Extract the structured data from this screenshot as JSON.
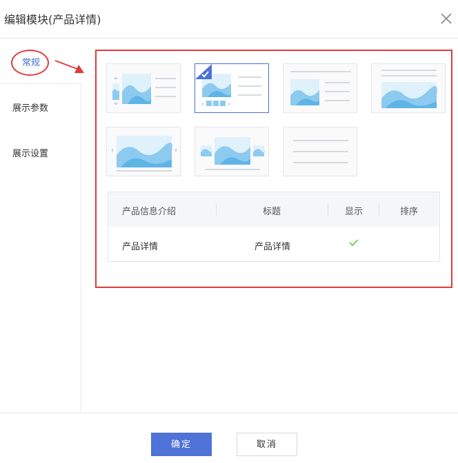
{
  "dialog": {
    "title": "编辑模块(产品详情)",
    "close_icon": "close-icon"
  },
  "sidebar": {
    "items": [
      {
        "label": "常规",
        "active": true
      },
      {
        "label": "展示参数",
        "active": false
      },
      {
        "label": "展示设置",
        "active": false
      }
    ]
  },
  "templates": {
    "selected_index": 1,
    "count": 7
  },
  "table": {
    "headers": [
      "产品信息介绍",
      "标题",
      "显示",
      "排序"
    ],
    "rows": [
      {
        "info": "产品详情",
        "title": "产品详情",
        "show": true,
        "sort": ""
      }
    ]
  },
  "footer": {
    "ok_label": "确定",
    "cancel_label": "取消"
  },
  "colors": {
    "accent": "#4f73d6",
    "annotation": "#e03a3a",
    "check": "#52c41a",
    "image_fill": "#8ccaf0"
  }
}
